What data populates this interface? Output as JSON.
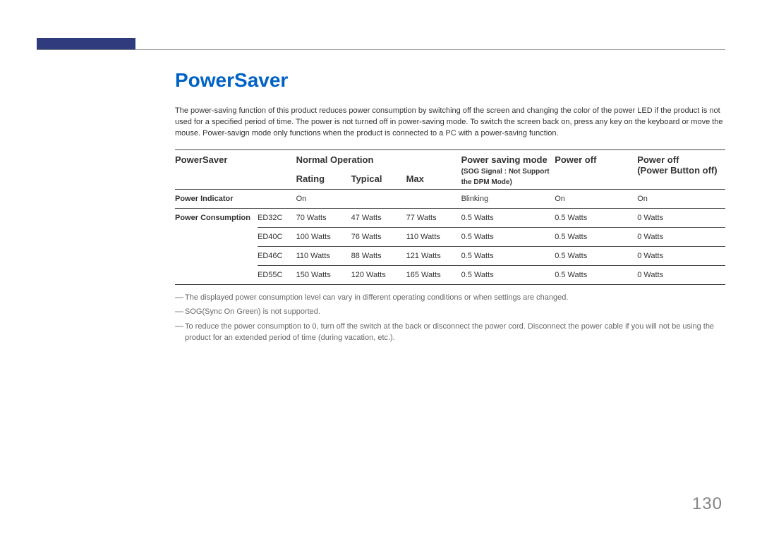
{
  "heading": "PowerSaver",
  "intro": "The power-saving function of this product reduces power consumption by switching off the screen and changing the color of the power LED if the product is not used for a specified period of time. The power is not turned off in power-saving mode. To switch the screen back on, press any key on the keyboard or move the mouse. Power-savign mode only functions when the product is connected to a PC with a power-saving function.",
  "columns": {
    "c1": "PowerSaver",
    "c2": "Normal Operation",
    "c2a": "Rating",
    "c2b": "Typical",
    "c2c": "Max",
    "c3": "Power saving mode",
    "c3sub": "(SOG Signal : Not Support the DPM Mode)",
    "c4": "Power off",
    "c5": "Power off",
    "c5sub": "(Power Button off)"
  },
  "rows": {
    "indicator": {
      "label": "Power Indicator",
      "normal": "On",
      "psm": "Blinking",
      "off1": "On",
      "off2": "On"
    },
    "consumption_label": "Power Consumption",
    "models": [
      {
        "name": "ED32C",
        "rating": "70 Watts",
        "typical": "47 Watts",
        "max": "77 Watts",
        "psm": "0.5 Watts",
        "off1": "0.5 Watts",
        "off2": "0 Watts"
      },
      {
        "name": "ED40C",
        "rating": "100 Watts",
        "typical": "76 Watts",
        "max": "110 Watts",
        "psm": "0.5 Watts",
        "off1": "0.5 Watts",
        "off2": "0 Watts"
      },
      {
        "name": "ED46C",
        "rating": "110 Watts",
        "typical": "88 Watts",
        "max": "121 Watts",
        "psm": "0.5 Watts",
        "off1": "0.5 Watts",
        "off2": "0 Watts"
      },
      {
        "name": "ED55C",
        "rating": "150 Watts",
        "typical": "120 Watts",
        "max": "165 Watts",
        "psm": "0.5 Watts",
        "off1": "0.5 Watts",
        "off2": "0 Watts"
      }
    ]
  },
  "notes": [
    "The displayed power consumption level can vary in different operating conditions or when settings are changed.",
    "SOG(Sync On Green) is not supported.",
    "To reduce the power consumption to 0, turn off the switch at the back or disconnect the power cord. Disconnect the power cable if you will not be using the product for an extended period of time (during vacation, etc.)."
  ],
  "page": "130"
}
